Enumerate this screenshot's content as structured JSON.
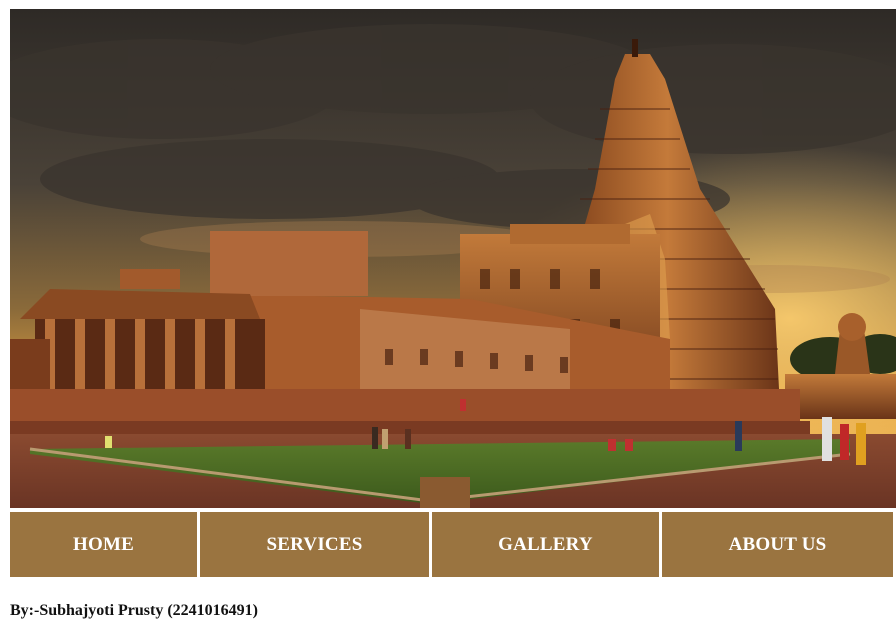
{
  "hero": {
    "image": "temple-at-sunset"
  },
  "nav": {
    "items": [
      {
        "label": "HOME"
      },
      {
        "label": "SERVICES"
      },
      {
        "label": "GALLERY"
      },
      {
        "label": "ABOUT US"
      }
    ],
    "color": "#9a7440",
    "text_color": "#ffffff"
  },
  "footer": {
    "credit": "By:-Subhajyoti Prusty (2241016491)"
  }
}
